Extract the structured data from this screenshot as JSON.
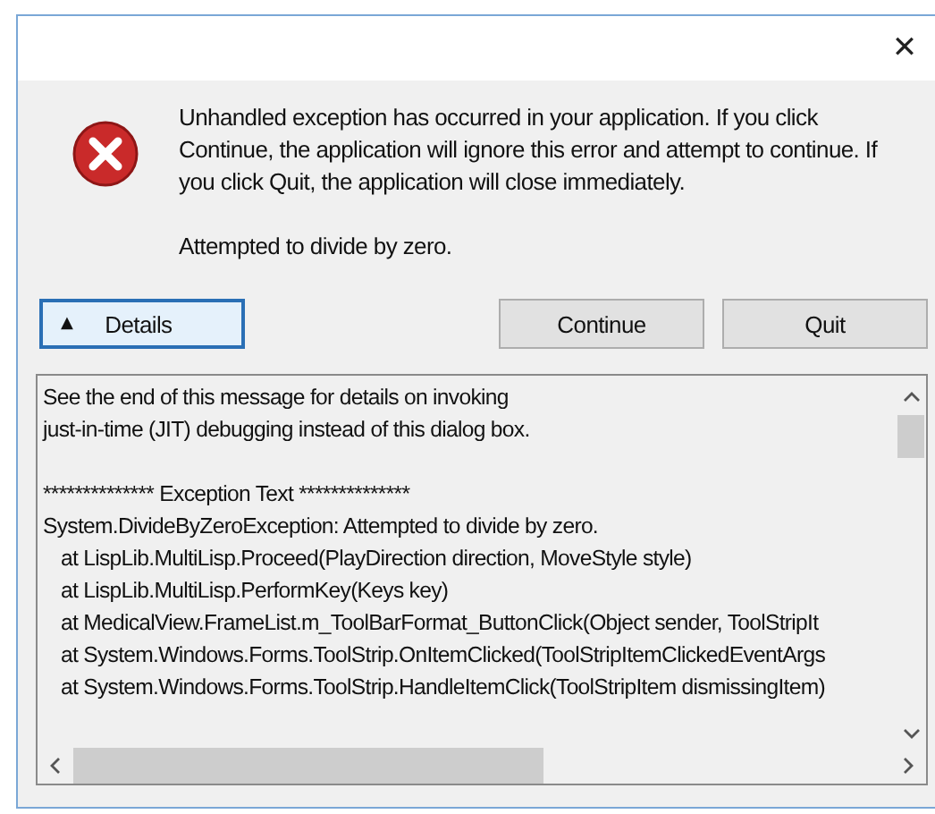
{
  "window": {
    "close": "✕"
  },
  "message": {
    "text": "Unhandled exception has occurred in your application. If you click Continue, the application will ignore this error and attempt to continue. If you click Quit, the application will close immediately.",
    "error": "Attempted to divide by zero."
  },
  "buttons": [
    {
      "kind": "toggle",
      "label": "Details",
      "expanded": true,
      "icon": "▲"
    },
    {
      "kind": "action",
      "label": "Continue"
    },
    {
      "kind": "action",
      "label": "Quit"
    }
  ],
  "details": {
    "paragraphs": [
      [
        {
          "kind": "text",
          "text": "See the end of this message for details on invoking"
        },
        {
          "kind": "text",
          "text": "just-in-time (JIT) debugging instead of this dialog box."
        }
      ],
      [
        {
          "kind": "text",
          "text": "************** Exception Text **************"
        },
        {
          "kind": "text",
          "text": "System.DivideByZeroException: Attempted to divide by zero."
        },
        {
          "kind": "frame",
          "text": "at LispLib.MultiLisp.Proceed(PlayDirection direction, MoveStyle style)"
        },
        {
          "kind": "frame",
          "text": "at LispLib.MultiLisp.PerformKey(Keys key)"
        },
        {
          "kind": "frame",
          "text": "at MedicalView.FrameList.m_ToolBarFormat_ButtonClick(Object sender, ToolStripIt"
        },
        {
          "kind": "frame",
          "text": "at System.Windows.Forms.ToolStrip.OnItemClicked(ToolStripItemClickedEventArgs"
        },
        {
          "kind": "frame",
          "text": "at System.Windows.Forms.ToolStrip.HandleItemClick(ToolStripItem dismissingItem)"
        }
      ]
    ]
  }
}
